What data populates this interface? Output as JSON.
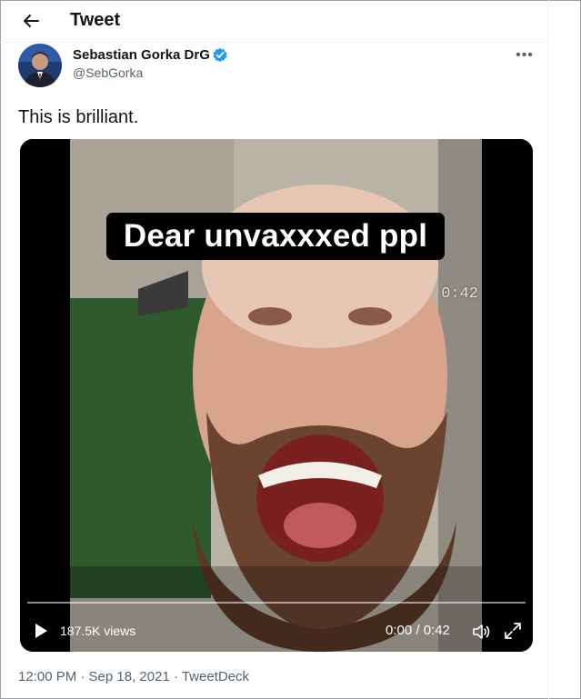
{
  "header": {
    "title": "Tweet"
  },
  "tweet": {
    "author_name": "Sebastian Gorka DrG",
    "author_handle": "@SebGorka",
    "text": "This is brilliant.",
    "date_time": "12:00 PM · Sep 18, 2021",
    "separator": " · ",
    "client": "TweetDeck"
  },
  "video": {
    "caption": "Dear unvaxxxed ppl",
    "corner_timestamp": "0:42",
    "views": "187.5K views",
    "time_display": "0:00 / 0:42",
    "progress": 0.0
  },
  "icons": {
    "back": "arrow-left-icon",
    "verified": "verified-badge-icon",
    "more": "more-icon",
    "play": "play-icon",
    "volume": "volume-icon",
    "fullscreen": "fullscreen-icon"
  },
  "colors": {
    "accent": "#1d9bf0",
    "text": "#0f1419",
    "secondary": "#536471"
  }
}
